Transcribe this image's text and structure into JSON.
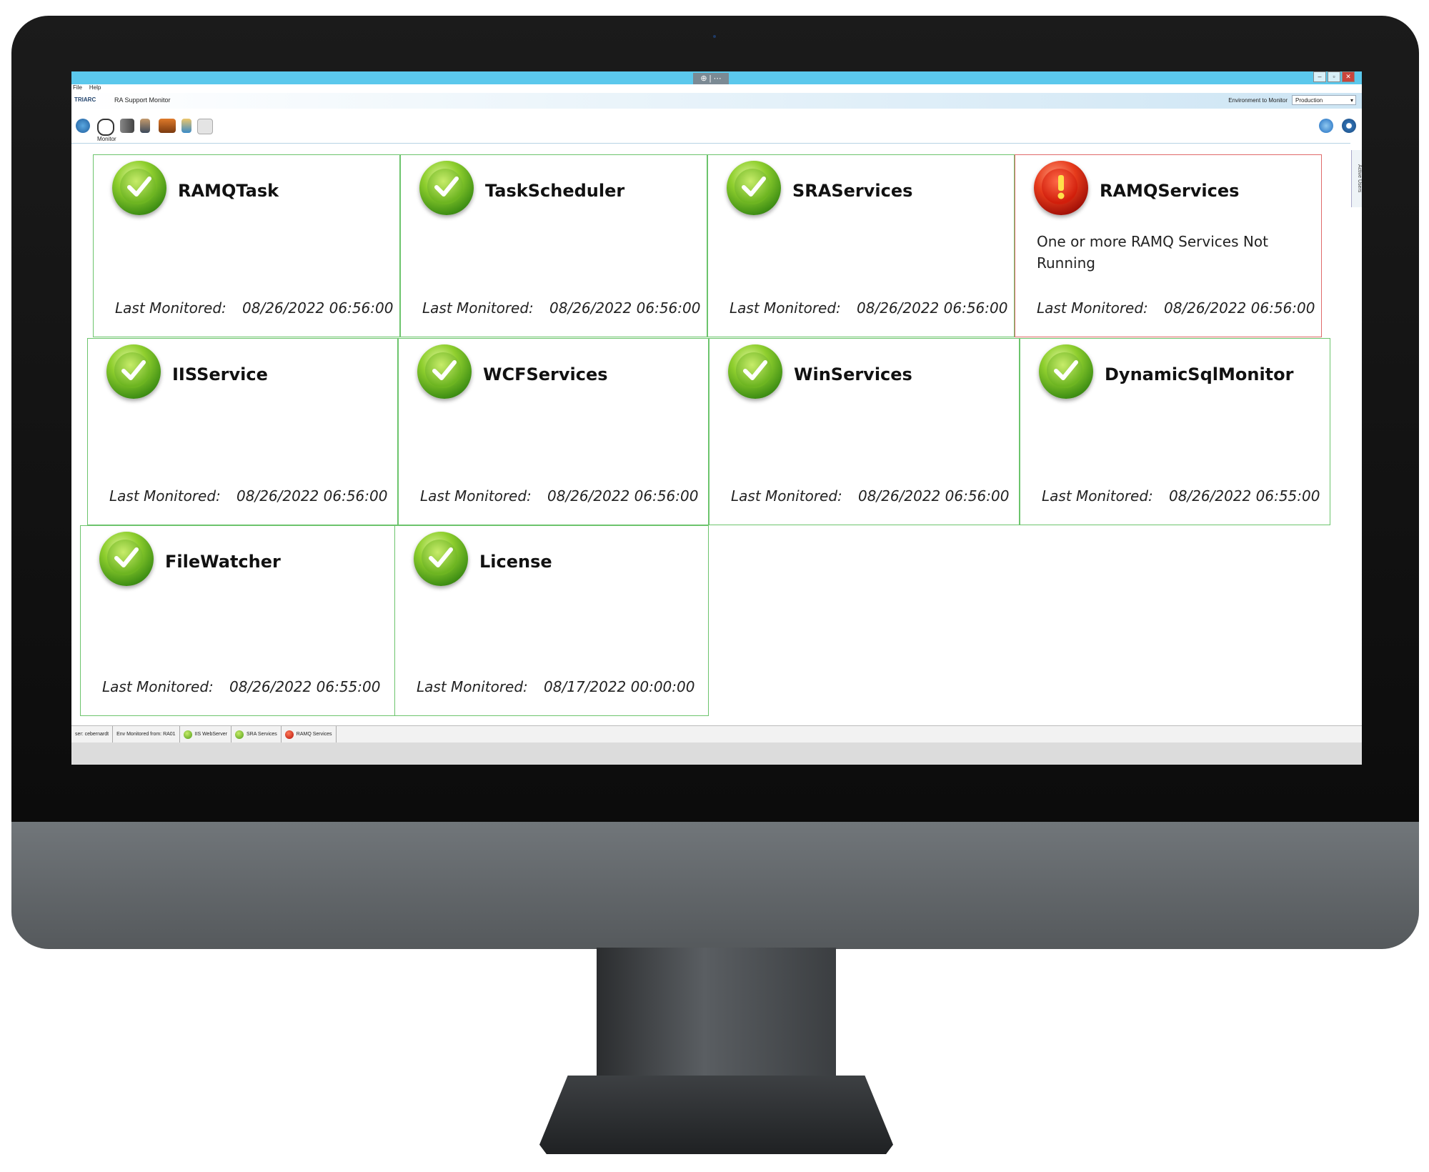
{
  "menu": {
    "file": "File",
    "help": "Help"
  },
  "app": {
    "brand": "TRIARC",
    "title": "RA Support Monitor",
    "environment_label": "Environment to Monitor",
    "environment_value": "Production",
    "toolbar_label": "Monitor",
    "side_tab": "Active Users"
  },
  "icons": {
    "toolbar": [
      "globe-icon",
      "eyes-icon",
      "server-icon",
      "person-icon",
      "folder-icon",
      "report-icon",
      "document-icon"
    ],
    "right": [
      "refresh-icon",
      "gear-icon"
    ]
  },
  "tiles": [
    {
      "name": "RAMQTask",
      "status": "ok",
      "message": "",
      "last_label": "Last Monitored:",
      "last_value": "08/26/2022 06:56:00"
    },
    {
      "name": "TaskScheduler",
      "status": "ok",
      "message": "",
      "last_label": "Last Monitored:",
      "last_value": "08/26/2022 06:56:00"
    },
    {
      "name": "SRAServices",
      "status": "ok",
      "message": "",
      "last_label": "Last Monitored:",
      "last_value": "08/26/2022 06:56:00"
    },
    {
      "name": "RAMQServices",
      "status": "error",
      "message": "One or more RAMQ Services Not Running",
      "last_label": "Last Monitored:",
      "last_value": "08/26/2022 06:56:00"
    },
    {
      "name": "IISService",
      "status": "ok",
      "message": "",
      "last_label": "Last Monitored:",
      "last_value": "08/26/2022 06:56:00"
    },
    {
      "name": "WCFServices",
      "status": "ok",
      "message": "",
      "last_label": "Last Monitored:",
      "last_value": "08/26/2022 06:56:00"
    },
    {
      "name": "WinServices",
      "status": "ok",
      "message": "",
      "last_label": "Last Monitored:",
      "last_value": "08/26/2022 06:56:00"
    },
    {
      "name": "DynamicSqlMonitor",
      "status": "ok",
      "message": "",
      "last_label": "Last Monitored:",
      "last_value": "08/26/2022 06:55:00"
    },
    {
      "name": "FileWatcher",
      "status": "ok",
      "message": "",
      "last_label": "Last Monitored:",
      "last_value": "08/26/2022 06:55:00"
    },
    {
      "name": "License",
      "status": "ok",
      "message": "",
      "last_label": "Last Monitored:",
      "last_value": "08/17/2022 00:00:00"
    }
  ],
  "statusbar": {
    "user": "ser: cebernardt",
    "env": "Env Monitored from: RA01",
    "items": [
      {
        "label": "IIS WebServer",
        "status": "ok"
      },
      {
        "label": "SRA Services",
        "status": "ok"
      },
      {
        "label": "RAMQ Services",
        "status": "error"
      }
    ]
  },
  "colors": {
    "ok_border": "#6cc46c",
    "error_border": "#e06a6a",
    "titlebar": "#5bc8ec"
  }
}
